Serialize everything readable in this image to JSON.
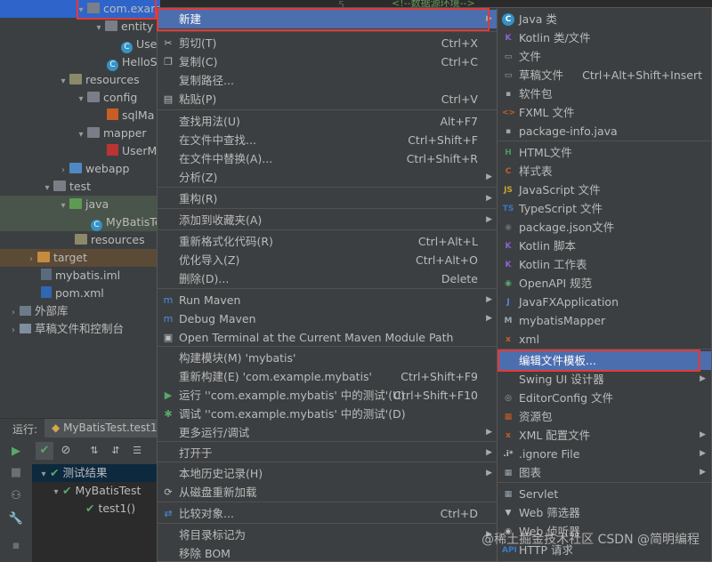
{
  "tree": {
    "items": [
      {
        "label": "com.example.mybatis",
        "icon": "package-folder-icon"
      },
      {
        "label": "entity",
        "icon": "package-folder-icon"
      },
      {
        "label": "Use",
        "icon": "class-icon"
      },
      {
        "label": "HelloS",
        "icon": "class-icon"
      },
      {
        "label": "resources",
        "icon": "resources-folder-icon"
      },
      {
        "label": "config",
        "icon": "folder-icon"
      },
      {
        "label": "sqlMa",
        "icon": "xml-file-icon"
      },
      {
        "label": "mapper",
        "icon": "folder-icon"
      },
      {
        "label": "UserM",
        "icon": "mybatis-file-icon"
      },
      {
        "label": "webapp",
        "icon": "web-folder-icon"
      },
      {
        "label": "test",
        "icon": "folder-icon"
      },
      {
        "label": "java",
        "icon": "test-source-folder-icon"
      },
      {
        "label": "MyBatisTe",
        "icon": "class-icon"
      },
      {
        "label": "resources",
        "icon": "test-resources-folder-icon"
      },
      {
        "label": "target",
        "icon": "excluded-folder-icon"
      },
      {
        "label": "mybatis.iml",
        "icon": "iml-file-icon"
      },
      {
        "label": "pom.xml",
        "icon": "maven-icon"
      },
      {
        "label": "外部库",
        "icon": "library-icon"
      },
      {
        "label": "草稿文件和控制台",
        "icon": "scratch-icon"
      }
    ]
  },
  "editor": {
    "line_number": "5",
    "line_text": "<!--数据源环境-->"
  },
  "run": {
    "label": "运行:",
    "tab": "MyBatisTest.test1",
    "results": [
      {
        "label": "测试结果"
      },
      {
        "label": "MyBatisTest"
      },
      {
        "label": "test1()"
      }
    ]
  },
  "context_menu": {
    "items": [
      {
        "label": "新建",
        "shortcut": "",
        "sub": true,
        "icon": ""
      },
      {
        "label": "剪切(T)",
        "shortcut": "Ctrl+X",
        "icon": "cut-icon"
      },
      {
        "label": "复制(C)",
        "shortcut": "Ctrl+C",
        "icon": "copy-icon"
      },
      {
        "label": "复制路径...",
        "shortcut": "",
        "icon": ""
      },
      {
        "label": "粘贴(P)",
        "shortcut": "Ctrl+V",
        "icon": "paste-icon"
      },
      {
        "label": "查找用法(U)",
        "shortcut": "Alt+F7",
        "icon": ""
      },
      {
        "label": "在文件中查找...",
        "shortcut": "Ctrl+Shift+F",
        "icon": ""
      },
      {
        "label": "在文件中替换(A)...",
        "shortcut": "Ctrl+Shift+R",
        "icon": ""
      },
      {
        "label": "分析(Z)",
        "shortcut": "",
        "sub": true,
        "icon": ""
      },
      {
        "label": "重构(R)",
        "shortcut": "",
        "sub": true,
        "icon": ""
      },
      {
        "label": "添加到收藏夹(A)",
        "shortcut": "",
        "sub": true,
        "icon": ""
      },
      {
        "label": "重新格式化代码(R)",
        "shortcut": "Ctrl+Alt+L",
        "icon": ""
      },
      {
        "label": "优化导入(Z)",
        "shortcut": "Ctrl+Alt+O",
        "icon": ""
      },
      {
        "label": "删除(D)...",
        "shortcut": "Delete",
        "icon": ""
      },
      {
        "label": "Run Maven",
        "shortcut": "",
        "sub": true,
        "icon": "maven-run-icon"
      },
      {
        "label": "Debug Maven",
        "shortcut": "",
        "sub": true,
        "icon": "maven-debug-icon"
      },
      {
        "label": "Open Terminal at the Current Maven Module Path",
        "shortcut": "",
        "icon": "terminal-icon"
      },
      {
        "label": "构建模块(M) 'mybatis'",
        "shortcut": "",
        "icon": ""
      },
      {
        "label": "重新构建(E) 'com.example.mybatis'",
        "shortcut": "Ctrl+Shift+F9",
        "icon": ""
      },
      {
        "label": "运行 ''com.example.mybatis' 中的测试'(U)",
        "shortcut": "Ctrl+Shift+F10",
        "icon": "run-icon"
      },
      {
        "label": "调试 ''com.example.mybatis' 中的测试'(D)",
        "shortcut": "",
        "icon": "debug-icon"
      },
      {
        "label": "更多运行/调试",
        "shortcut": "",
        "sub": true,
        "icon": ""
      },
      {
        "label": "打开于",
        "shortcut": "",
        "sub": true,
        "icon": ""
      },
      {
        "label": "本地历史记录(H)",
        "shortcut": "",
        "sub": true,
        "icon": ""
      },
      {
        "label": "从磁盘重新加载",
        "shortcut": "",
        "icon": "reload-icon"
      },
      {
        "label": "比较对象...",
        "shortcut": "Ctrl+D",
        "icon": "compare-icon"
      },
      {
        "label": "将目录标记为",
        "shortcut": "",
        "sub": true,
        "icon": ""
      },
      {
        "label": "移除 BOM",
        "shortcut": "",
        "icon": ""
      }
    ]
  },
  "new_menu": {
    "items": [
      {
        "label": "Java 类",
        "shortcut": "",
        "icon": "java-class-icon"
      },
      {
        "label": "Kotlin 类/文件",
        "shortcut": "",
        "icon": "kotlin-icon"
      },
      {
        "label": "文件",
        "shortcut": "",
        "icon": "file-icon"
      },
      {
        "label": "草稿文件",
        "shortcut": "Ctrl+Alt+Shift+Insert",
        "icon": "scratch-file-icon"
      },
      {
        "label": "软件包",
        "shortcut": "",
        "icon": "package-icon"
      },
      {
        "label": "FXML 文件",
        "shortcut": "",
        "icon": "fxml-icon"
      },
      {
        "label": "package-info.java",
        "shortcut": "",
        "icon": "package-info-icon"
      },
      {
        "label": "HTML文件",
        "shortcut": "",
        "icon": "html-icon"
      },
      {
        "label": "样式表",
        "shortcut": "",
        "icon": "css-icon"
      },
      {
        "label": "JavaScript 文件",
        "shortcut": "",
        "icon": "javascript-icon"
      },
      {
        "label": "TypeScript 文件",
        "shortcut": "",
        "icon": "typescript-icon"
      },
      {
        "label": "package.json文件",
        "shortcut": "",
        "icon": "npm-icon"
      },
      {
        "label": "Kotlin 脚本",
        "shortcut": "",
        "icon": "kotlin-script-icon"
      },
      {
        "label": "Kotlin 工作表",
        "shortcut": "",
        "icon": "kotlin-worksheet-icon"
      },
      {
        "label": "OpenAPI 规范",
        "shortcut": "",
        "icon": "openapi-icon"
      },
      {
        "label": "JavaFXApplication",
        "shortcut": "",
        "icon": "javafx-icon"
      },
      {
        "label": "mybatisMapper",
        "shortcut": "",
        "icon": "mybatis-icon"
      },
      {
        "label": "xml",
        "shortcut": "",
        "icon": "xml-icon"
      },
      {
        "label": "编辑文件模板...",
        "shortcut": "",
        "icon": ""
      },
      {
        "label": "Swing UI 设计器",
        "shortcut": "",
        "sub": true,
        "icon": ""
      },
      {
        "label": "EditorConfig 文件",
        "shortcut": "",
        "icon": "editorconfig-icon"
      },
      {
        "label": "资源包",
        "shortcut": "",
        "icon": "resource-bundle-icon"
      },
      {
        "label": "XML 配置文件",
        "shortcut": "",
        "sub": true,
        "icon": "xml-config-icon"
      },
      {
        "label": ".ignore File",
        "shortcut": "",
        "sub": true,
        "icon": "ignore-file-icon"
      },
      {
        "label": "图表",
        "shortcut": "",
        "sub": true,
        "icon": "diagram-icon"
      },
      {
        "label": "Servlet",
        "shortcut": "",
        "icon": "servlet-icon"
      },
      {
        "label": "Web 筛选器",
        "shortcut": "",
        "icon": "web-filter-icon"
      },
      {
        "label": "Web 侦听器",
        "shortcut": "",
        "icon": "web-listener-icon"
      },
      {
        "label": "HTTP 请求",
        "shortcut": "",
        "icon": "http-request-icon"
      }
    ]
  },
  "watermark": "@稀土掘金技术社区 CSDN @简明编程",
  "colors": {
    "selection": "#4b6eaf",
    "highlight_box": "#e53935",
    "background": "#3c3f41"
  }
}
